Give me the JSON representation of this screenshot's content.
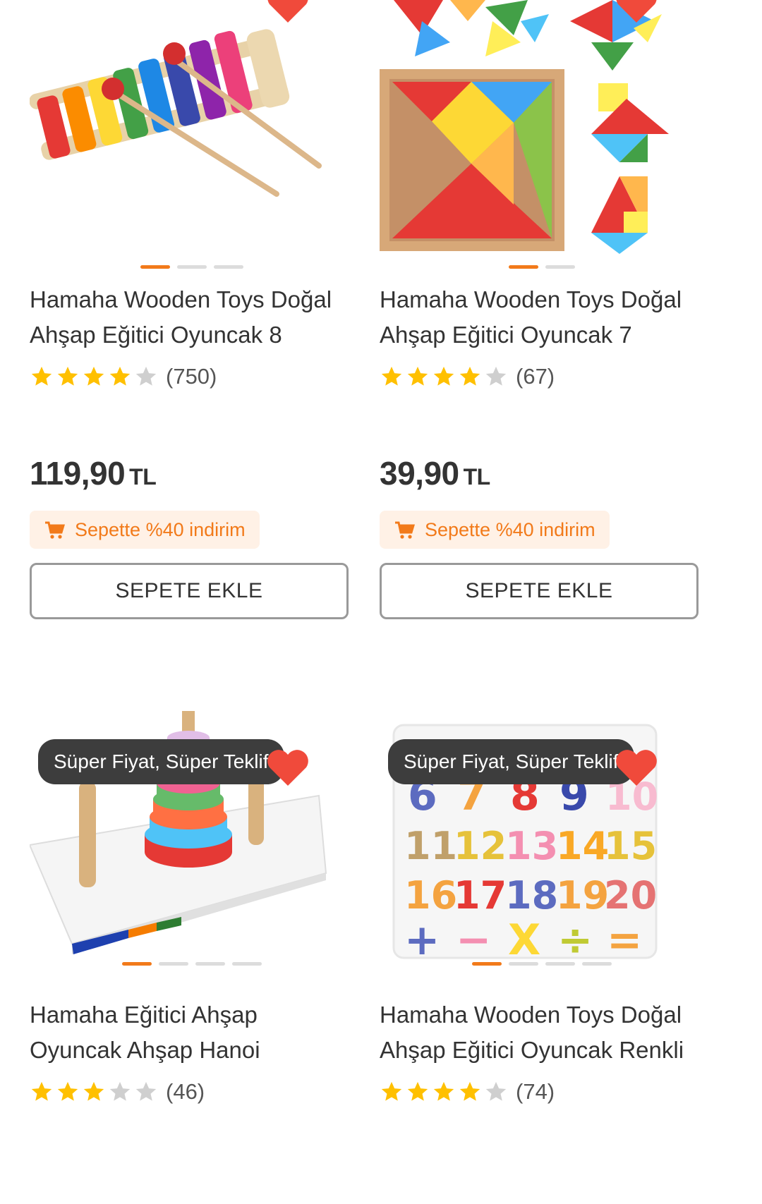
{
  "products": [
    {
      "badge": "",
      "image_icon": "xylophone-toy-image",
      "title": "Hamaha Wooden Toys Doğal Ahşap Eğitici Oyuncak 8",
      "rating": 4,
      "review_count": "(750)",
      "price": "119,90",
      "currency": "TL",
      "promo": "Sepette %40 indirim",
      "button": "SEPETE EKLE",
      "image_dots": 3,
      "active_dot": 0
    },
    {
      "badge": "",
      "image_icon": "tangram-puzzle-image",
      "title": "Hamaha Wooden Toys Doğal Ahşap Eğitici Oyuncak 7",
      "rating": 4,
      "review_count": "(67)",
      "price": "39,90",
      "currency": "TL",
      "promo": "Sepette %40 indirim",
      "button": "SEPETE EKLE",
      "image_dots": 2,
      "active_dot": 0
    },
    {
      "badge": "Süper Fiyat, Süper Teklif",
      "image_icon": "hanoi-tower-toy-image",
      "title": "Hamaha Eğitici Ahşap Oyuncak Ahşap Hanoi",
      "rating": 3,
      "review_count": "(46)",
      "price": "",
      "currency": "",
      "promo": "",
      "button": "",
      "image_dots": 4,
      "active_dot": 0
    },
    {
      "badge": "Süper Fiyat, Süper Teklif",
      "image_icon": "number-puzzle-image",
      "title": "Hamaha Wooden Toys Doğal Ahşap Eğitici Oyuncak Renkli",
      "rating": 4,
      "review_count": "(74)",
      "price": "",
      "currency": "",
      "promo": "",
      "button": "",
      "image_dots": 4,
      "active_dot": 0
    }
  ],
  "colors": {
    "accent": "#f27a1a",
    "heart": "#f04a3b",
    "star_on": "#ffc000",
    "star_off": "#cfcfcf"
  }
}
